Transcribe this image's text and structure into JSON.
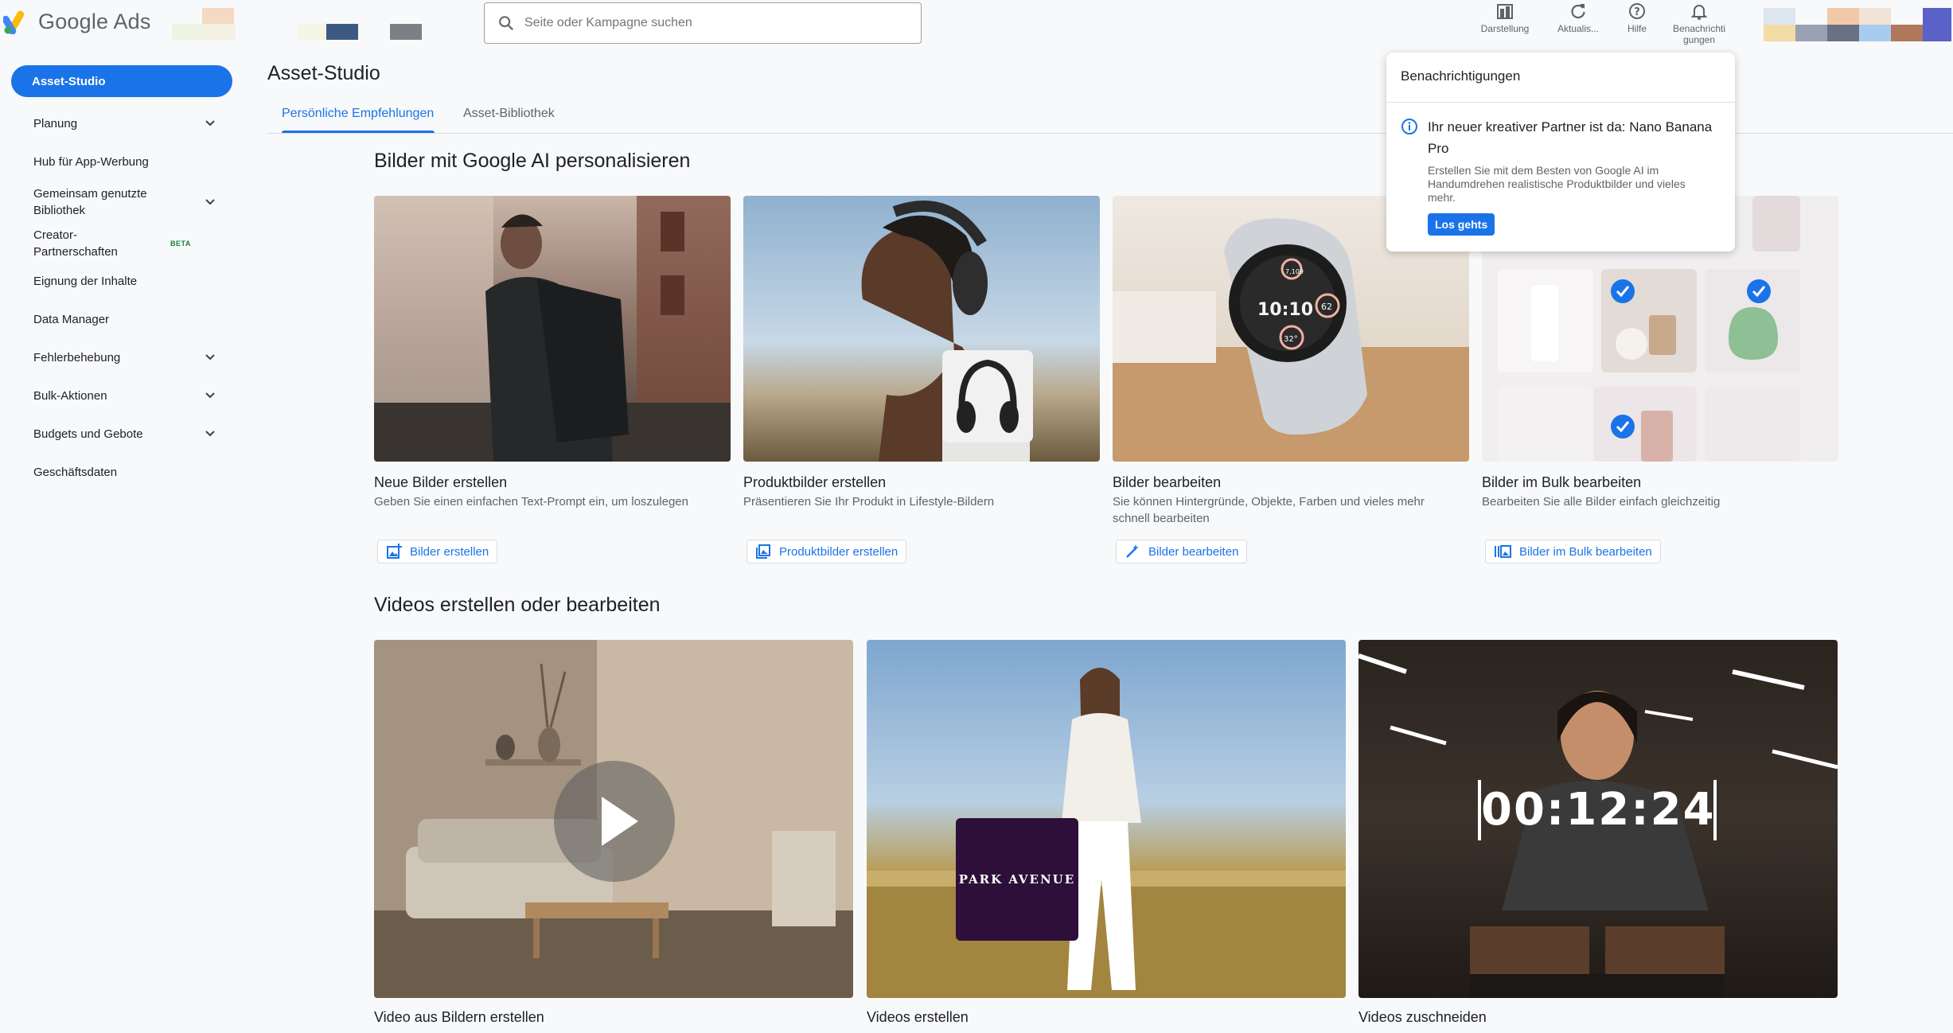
{
  "header": {
    "app_name": "Google Ads",
    "search_placeholder": "Seite oder Kampagne suchen",
    "buttons": [
      {
        "label": "Darstellung",
        "icon": "appearance-icon"
      },
      {
        "label": "Aktualis...",
        "icon": "refresh-icon"
      },
      {
        "label": "Hilfe",
        "icon": "help-icon"
      },
      {
        "label": "Benachrichti gungen",
        "icon": "bell-icon"
      }
    ]
  },
  "sidebar": {
    "items": [
      {
        "label": "Asset-Studio",
        "active": true
      },
      {
        "label": "Planung",
        "expandable": true
      },
      {
        "label": "Hub für App-Werbung"
      },
      {
        "label": "Gemeinsam genutzte Bibliothek",
        "expandable": true
      },
      {
        "label": "Creator-Partnerschaften",
        "badge": "BETA"
      },
      {
        "label": "Eignung der Inhalte"
      },
      {
        "label": "Data Manager"
      },
      {
        "label": "Fehlerbehebung",
        "expandable": true
      },
      {
        "label": "Bulk-Aktionen",
        "expandable": true
      },
      {
        "label": "Budgets und Gebote",
        "expandable": true
      },
      {
        "label": "Geschäftsdaten"
      }
    ]
  },
  "main": {
    "title": "Asset-Studio",
    "tabs": [
      {
        "label": "Persönliche Empfehlungen",
        "active": true
      },
      {
        "label": "Asset-Bibliothek"
      }
    ],
    "images_section": {
      "title": "Bilder mit Google AI personalisieren",
      "cards": [
        {
          "title": "Neue Bilder erstellen",
          "desc": "Geben Sie einen einfachen Text-Prompt ein, um loszulegen",
          "button": "Bilder erstellen"
        },
        {
          "title": "Produktbilder erstellen",
          "desc": "Präsentieren Sie Ihr Produkt in Lifestyle-Bildern",
          "button": "Produktbilder erstellen"
        },
        {
          "title": "Bilder bearbeiten",
          "desc": "Sie können Hintergründe, Objekte, Farben und vieles mehr schnell bearbeiten",
          "button": "Bilder bearbeiten"
        },
        {
          "title": "Bilder im Bulk bearbeiten",
          "desc": "Bearbeiten Sie alle Bilder einfach gleichzeitig",
          "button": "Bilder im Bulk bearbeiten"
        }
      ]
    },
    "videos_section": {
      "title": "Videos erstellen oder bearbeiten",
      "cards": [
        {
          "title": "Video aus Bildern erstellen"
        },
        {
          "title": "Videos erstellen",
          "overlay": "PARK AVENUE"
        },
        {
          "title": "Videos zuschneiden",
          "overlay": "00:12:24"
        }
      ]
    },
    "watch": {
      "time": "10:10",
      "top": "7,109",
      "right": "62",
      "bottom": "32°"
    }
  },
  "notification": {
    "header": "Benachrichtigungen",
    "title": "Ihr neuer kreativer Partner ist da: Nano Banana Pro",
    "body": "Erstellen Sie mit dem Besten von Google AI im Handumdrehen realistische Produktbilder und vieles mehr.",
    "button": "Los gehts"
  },
  "colors": {
    "accent": "#1a73e8",
    "text": "#202124",
    "muted": "#5f6368",
    "beta": "#188038"
  }
}
